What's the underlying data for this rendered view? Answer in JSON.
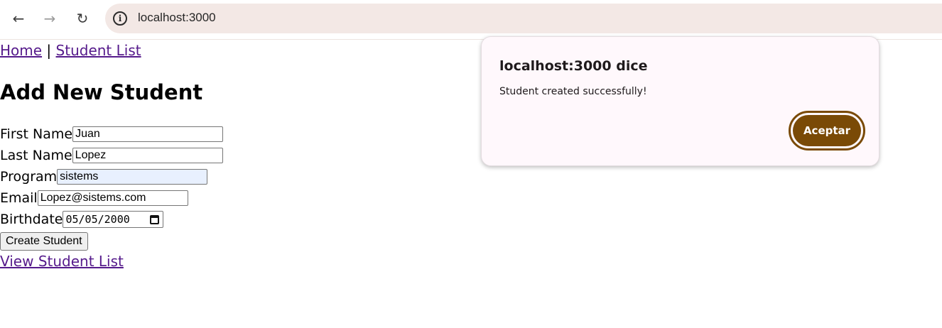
{
  "browser": {
    "url": "localhost:3000",
    "back_icon": "arrow-left",
    "forward_icon": "arrow-right",
    "reload_icon": "reload",
    "info_icon": "info-circle"
  },
  "nav": {
    "home_link": "Home",
    "separator": "|",
    "student_list_link": "Student List"
  },
  "page": {
    "heading": "Add New Student"
  },
  "form": {
    "first_name": {
      "label": "First Name",
      "value": "Juan"
    },
    "last_name": {
      "label": "Last Name",
      "value": "Lopez"
    },
    "program": {
      "label": "Program",
      "value": "sistems"
    },
    "email": {
      "label": "Email",
      "value": "Lopez@sistems.com"
    },
    "birthdate": {
      "label": "Birthdate",
      "value": "05/05/2000",
      "icon": "calendar"
    },
    "submit_label": "Create Student"
  },
  "footer": {
    "view_list_link": "View Student List"
  },
  "dialog": {
    "title": "localhost:3000 dice",
    "message": "Student created successfully!",
    "ok_label": "Aceptar",
    "ok_color": "#7a4a06"
  }
}
